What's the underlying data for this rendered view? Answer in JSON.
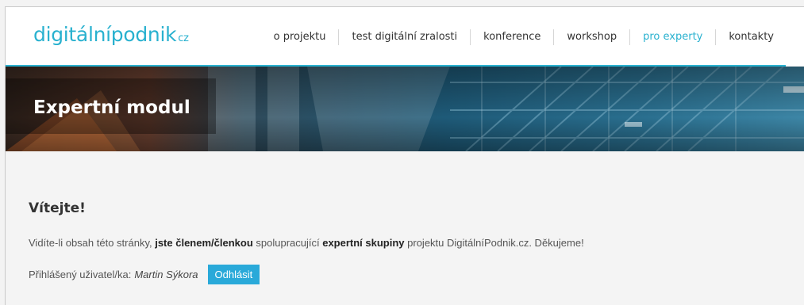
{
  "logo": {
    "text": "digitálnípodnik",
    "suffix": "cz"
  },
  "nav": {
    "items": [
      {
        "label": "o projektu"
      },
      {
        "label": "test digitální zralosti"
      },
      {
        "label": "konference"
      },
      {
        "label": "workshop"
      },
      {
        "label": "pro experty"
      },
      {
        "label": "kontakty"
      }
    ],
    "active_color": "#29b1cf"
  },
  "hero": {
    "title": "Expertní modul"
  },
  "main": {
    "heading": "Vítejte!",
    "para": {
      "part1": "Vidíte-li obsah této stránky, ",
      "bold1": "jste členem/členkou",
      "part2": " spolupracující ",
      "bold2": "expertní skupiny",
      "part3": " projektu DigitálníPodnik.cz. Děkujeme!"
    },
    "user": {
      "label": "Přihlášený uživatel/ka:",
      "name": "Martin Sýkora",
      "logout_label": "Odhlásit"
    }
  },
  "colors": {
    "accent": "#29b1cf",
    "button": "#29a9d9"
  }
}
